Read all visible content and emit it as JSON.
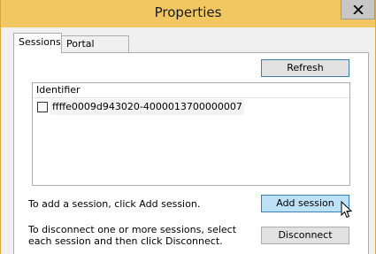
{
  "window": {
    "title": "Properties"
  },
  "tabs": [
    {
      "label": "Sessions",
      "active": true
    },
    {
      "label": "Portal Groups",
      "active": false
    }
  ],
  "buttons": {
    "refresh": "Refresh",
    "add_session": "Add session",
    "disconnect": "Disconnect"
  },
  "sessions_list": {
    "column_header": "Identifier",
    "rows": [
      {
        "identifier": "ffffe0009d943020-4000013700000007",
        "checked": false
      }
    ]
  },
  "instructions": {
    "add": "To add a session, click Add session.",
    "disconnect": "To disconnect one or more sessions, select each session and then click Disconnect."
  },
  "icons": {
    "close": "close-icon",
    "cursor": "mouse-pointer-icon"
  },
  "colors": {
    "titlebar": "#f2c660",
    "accent": "#3c7fb1",
    "hover_button": "#bde2f8"
  }
}
